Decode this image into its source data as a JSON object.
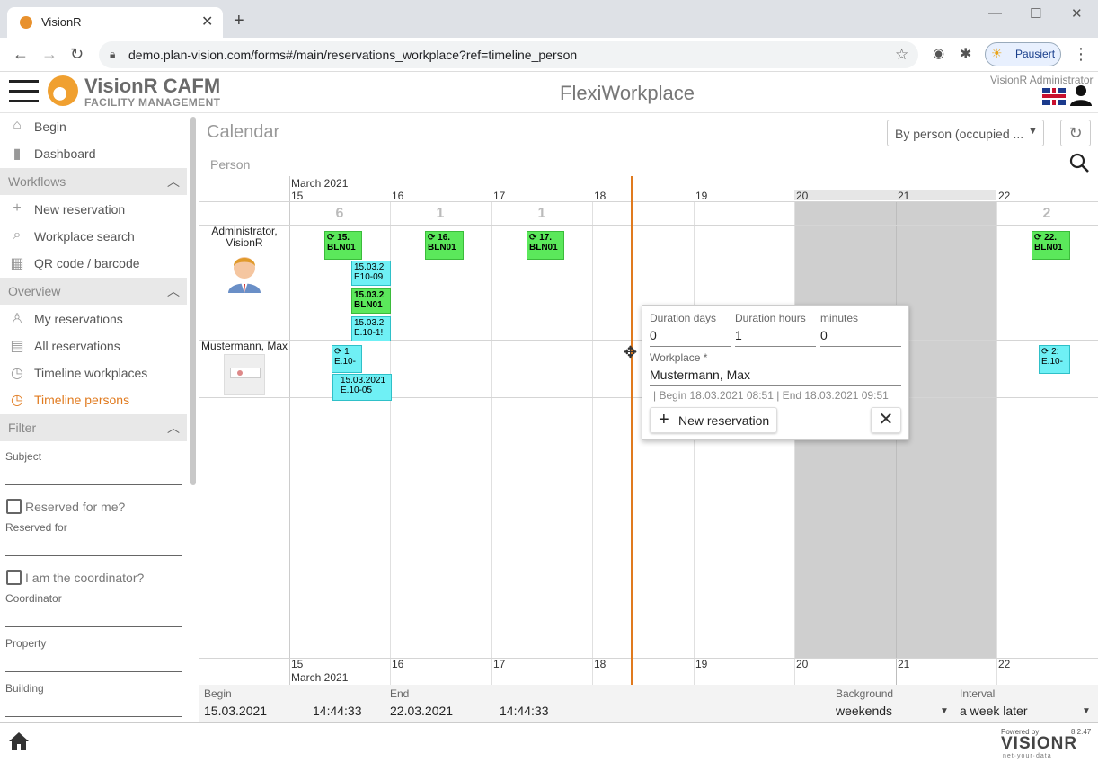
{
  "browser": {
    "tab_title": "VisionR",
    "new_tab": "+",
    "url": "demo.plan-vision.com/forms#/main/reservations_workplace?ref=timeline_person",
    "profile_label": "Pausiert",
    "window_min": "—",
    "window_max": "☐",
    "window_close": "✕"
  },
  "header": {
    "brand": "VisionR CAFM",
    "brand_sub": "FACILITY MANAGEMENT",
    "app_title": "FlexiWorkplace",
    "user": "VisionR Administrator"
  },
  "sidebar": {
    "top_items": [
      {
        "label": "Begin",
        "icon": "home-icon"
      },
      {
        "label": "Dashboard",
        "icon": "bar-chart-icon"
      }
    ],
    "workflows": {
      "title": "Workflows",
      "items": [
        {
          "label": "New reservation",
          "icon": "plus-icon"
        },
        {
          "label": "Workplace search",
          "icon": "search-icon"
        },
        {
          "label": "QR code / barcode",
          "icon": "qr-code-icon"
        }
      ]
    },
    "overview": {
      "title": "Overview",
      "items": [
        {
          "label": "My reservations",
          "icon": "person-icon"
        },
        {
          "label": "All reservations",
          "icon": "calendar-icon"
        },
        {
          "label": "Timeline workplaces",
          "icon": "clock-icon"
        },
        {
          "label": "Timeline persons",
          "icon": "clock-icon",
          "active": true
        }
      ]
    },
    "filter": {
      "title": "Filter",
      "subject": "Subject",
      "reserved_for_me": "Reserved for me?",
      "reserved_for": "Reserved for",
      "coordinator_check": "I am the coordinator?",
      "coordinator": "Coordinator",
      "property": "Property",
      "building": "Building"
    }
  },
  "main": {
    "title": "Calendar",
    "group_label": "Person",
    "view_select": "By person (occupied ...",
    "month_top": "March 2021",
    "month_bottom": "March 2021",
    "days": [
      "15",
      "16",
      "17",
      "18",
      "19",
      "20",
      "21",
      "22"
    ],
    "counts": [
      "6",
      "1",
      "1",
      "",
      "",
      "",
      "",
      "2"
    ],
    "persons": [
      {
        "name": "Administrator,\nVisionR"
      },
      {
        "name": "Mustermann, Max"
      }
    ],
    "events": [
      {
        "text1": "15.",
        "text2": "BLN01",
        "color": "green",
        "recurring": true
      },
      {
        "text1": "16.",
        "text2": "BLN01",
        "color": "green",
        "recurring": true
      },
      {
        "text1": "17.",
        "text2": "BLN01",
        "color": "green",
        "recurring": true
      },
      {
        "text1": "22.",
        "text2": "BLN01",
        "color": "green",
        "recurring": true
      },
      {
        "text1": "15.03.2",
        "text2": "E10-09",
        "color": "cyan",
        "recurring": false
      },
      {
        "text1": "15.03.2",
        "text2": "BLN01",
        "color": "green",
        "recurring": false
      },
      {
        "text1": "15.03.2",
        "text2": "E.10-1!",
        "color": "cyan",
        "recurring": false
      },
      {
        "text1": "1",
        "text2": "E.10-",
        "color": "cyan",
        "recurring": true
      },
      {
        "text1": "15.03.2021",
        "text2": "E.10-05",
        "color": "cyan",
        "recurring": false
      },
      {
        "text1": "2:",
        "text2": "E.10-",
        "color": "cyan",
        "recurring": true
      }
    ]
  },
  "popup": {
    "duration_days_label": "Duration days",
    "duration_days": "0",
    "duration_hours_label": "Duration hours",
    "duration_hours": "1",
    "minutes_label": "minutes",
    "minutes": "0",
    "workplace_label": "Workplace *",
    "workplace": "Mustermann, Max",
    "range": "| Begin 18.03.2021 08:51 | End 18.03.2021 09:51",
    "new_button": "New reservation"
  },
  "bottom": {
    "begin_label": "Begin",
    "begin_date": "15.03.2021",
    "begin_time": "14:44:33",
    "end_label": "End",
    "end_date": "22.03.2021",
    "end_time": "14:44:33",
    "background_label": "Background",
    "background_value": "weekends",
    "interval_label": "Interval",
    "interval_value": "a week later"
  },
  "footer": {
    "powered_by": "Powered by",
    "version": "8.2.47",
    "logo_text": "VISIONR",
    "logo_tag": "net·your·data"
  },
  "colors": {
    "accent": "#e07a1e",
    "event_green": "#5be85b",
    "event_cyan": "#6ff0f5",
    "weekend": "#cfcfcf"
  }
}
